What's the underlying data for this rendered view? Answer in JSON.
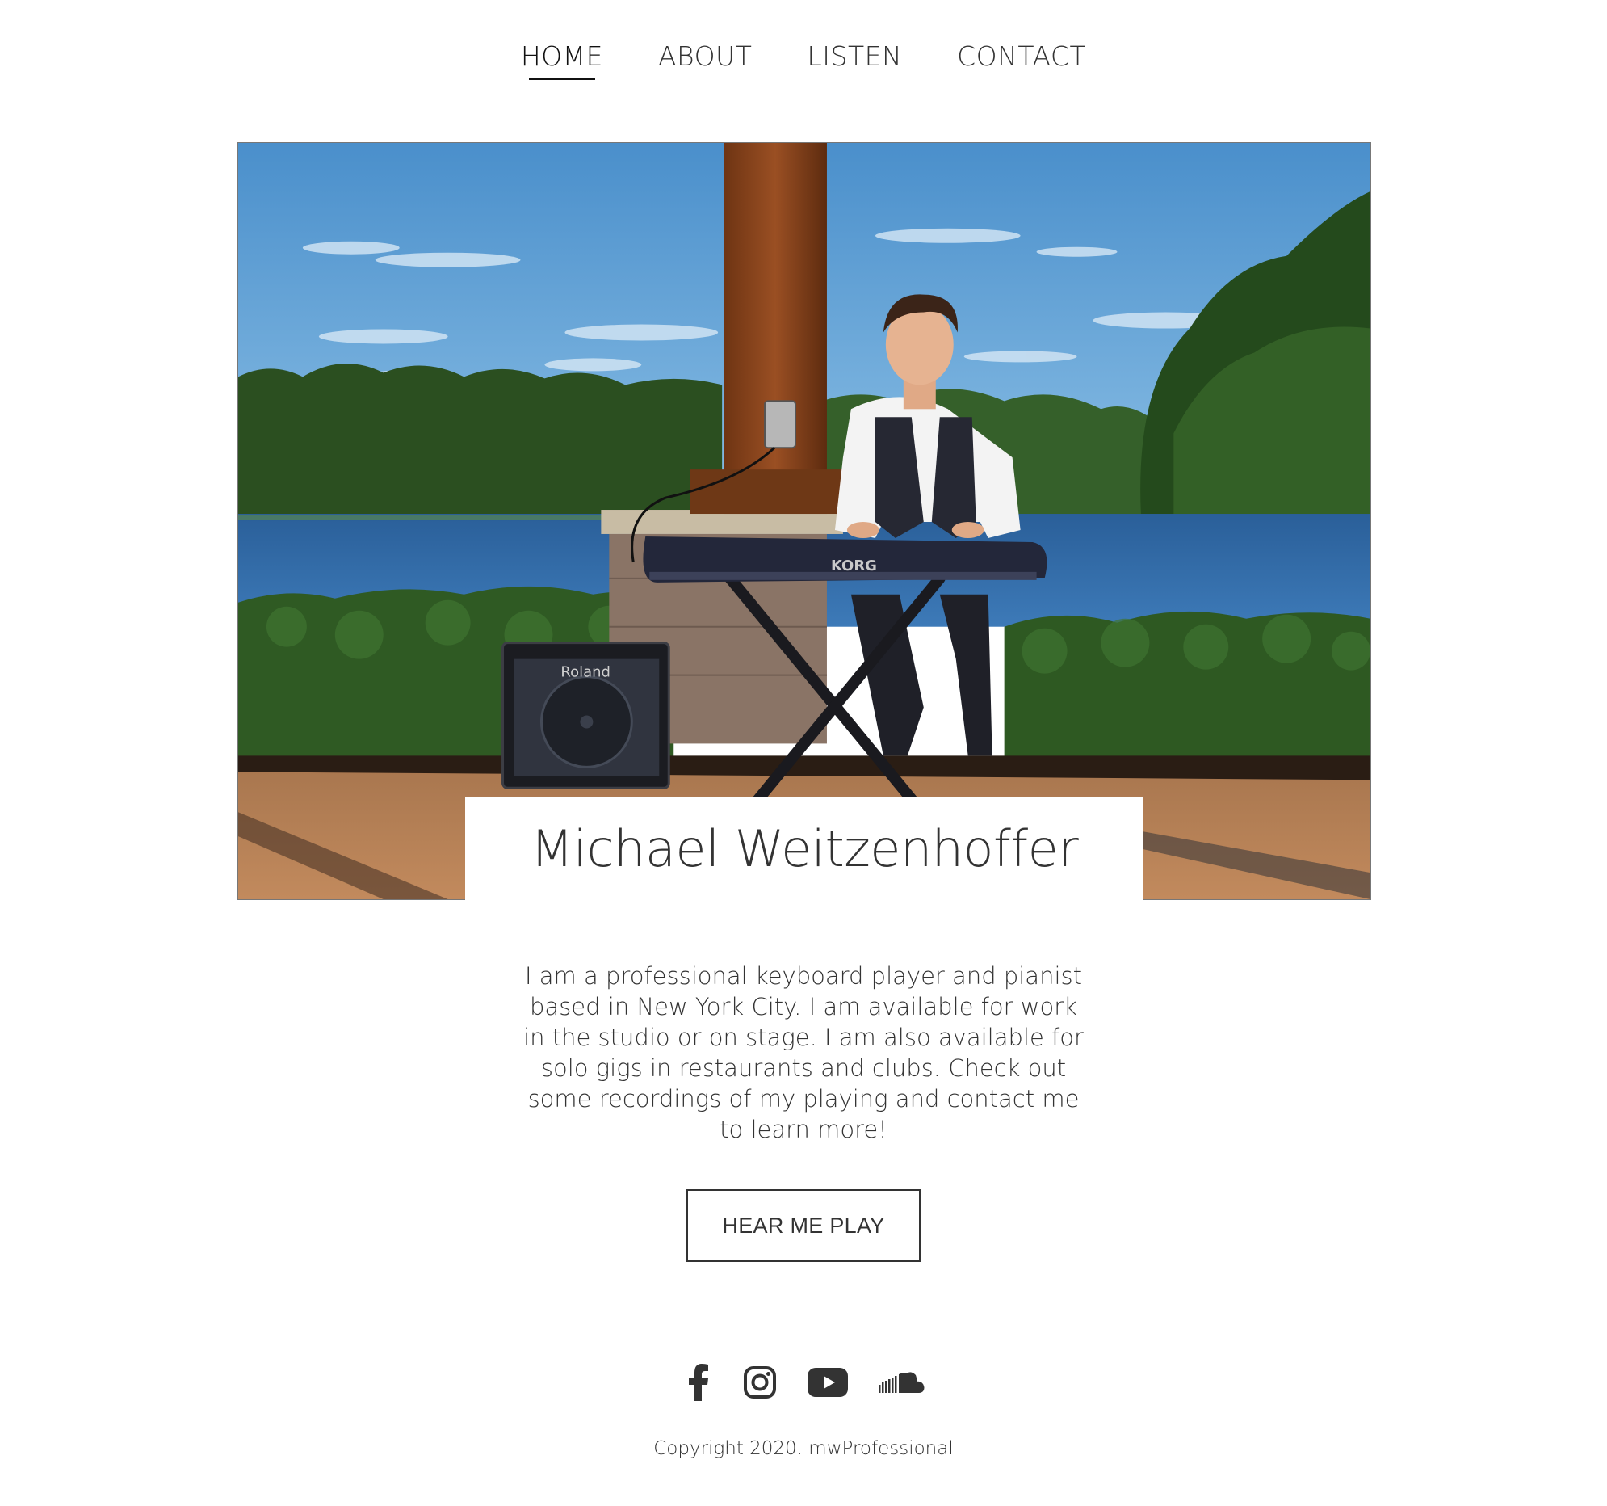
{
  "nav": {
    "items": [
      {
        "label": "HOME",
        "active": true
      },
      {
        "label": "ABOUT",
        "active": false
      },
      {
        "label": "LISTEN",
        "active": false
      },
      {
        "label": "CONTACT",
        "active": false
      }
    ]
  },
  "hero": {
    "amp_label": "Roland",
    "keyboard_label": "KORG",
    "name": "Michael Weitzenhoffer"
  },
  "intro": {
    "text": "I am a professional keyboard player and pianist based in New York City. I am available for work in the studio or on stage. I am also available for solo gigs in restaurants and clubs. Check out some recordings of my playing and contact me to learn more!"
  },
  "cta": {
    "label": "HEAR ME PLAY"
  },
  "social": {
    "icons": [
      "facebook-icon",
      "instagram-icon",
      "youtube-icon",
      "soundcloud-icon"
    ]
  },
  "footer": {
    "copyright": "Copyright 2020. mwProfessional"
  },
  "colors": {
    "text": "#333333",
    "background": "#ffffff",
    "sky": "#5d9fd3",
    "water": "#2f6aa6",
    "foliage": "#2f5a23"
  }
}
